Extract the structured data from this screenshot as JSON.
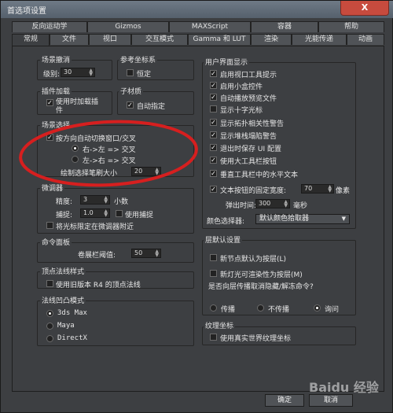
{
  "window": {
    "title": "首选项设置",
    "close": "X"
  },
  "tabs_row1": [
    "反向运动学",
    "Gizmos",
    "MAXScript",
    "容器",
    "帮助"
  ],
  "tabs_row2": [
    "常规",
    "文件",
    "视口",
    "交互模式",
    "Gamma 和 LUT",
    "渲染",
    "光能传递",
    "动画"
  ],
  "scene_undo": {
    "title": "场景撤消",
    "levels_label": "级别:",
    "levels_value": "30"
  },
  "ref_coord": {
    "title": "参考坐标系",
    "constant_label": "恒定"
  },
  "plugin_load": {
    "title": "插件加载",
    "load_on_demand": "使用时加载插件"
  },
  "sub_material": {
    "title": "子材质",
    "auto_assign": "自动指定"
  },
  "scene_select": {
    "title": "场景选择",
    "auto_switch": "按方向自动切换窗口/交叉",
    "right_left": "右->左 => 交叉",
    "left_right": "左->右 => 交叉",
    "paint_size_label": "绘制选择笔刷大小",
    "paint_size_value": "20"
  },
  "spinners": {
    "title": "微调器",
    "precision_label": "精度:",
    "precision_value": "3",
    "decimals": "小数",
    "snap_label": "捕捉:",
    "snap_value": "1.0",
    "use_snap": "使用捕捉",
    "cursor_wrap": "将光标限定在微调器附近"
  },
  "command_panel": {
    "title": "命令面板",
    "rollup_label": "卷展栏阈值:",
    "rollup_value": "50"
  },
  "vertex_normal": {
    "title": "顶点法线样式",
    "legacy": "使用旧版本 R4 的顶点法线"
  },
  "gizmo_mode": {
    "title": "法线凹凸模式",
    "options": [
      "3ds Max",
      "Maya",
      "DirectX"
    ]
  },
  "ui_display": {
    "title": "用户界面显示",
    "items": [
      "启用视口工具提示",
      "启用小盒控件",
      "自动播放预览文件",
      "显示十字光标",
      "显示拓扑相关性警告",
      "显示堆栈塌陷警告",
      "退出时保存 UI 配置",
      "使用大工具栏按钮",
      "垂直工具栏中的水平文本"
    ],
    "fixed_width_label": "文本按钮的固定宽度:",
    "fixed_width_value": "70",
    "pixels": "像素",
    "flyout_label": "弹出时间:",
    "flyout_value": "300",
    "ms": "毫秒",
    "color_picker_label": "颜色选择器:",
    "color_picker_value": "默认颜色拾取器"
  },
  "layer_defaults": {
    "title": "层默认设置",
    "new_nodes": "新节点默认为按层(L)",
    "new_lights": "新灯光可渲染性为按层(M)",
    "propagate_q": "是否向层传播取消隐藏/解冻命令?",
    "options": [
      "传播",
      "不传播",
      "询问"
    ]
  },
  "texture_coords": {
    "title": "纹理坐标",
    "real_world": "使用真实世界纹理坐标"
  },
  "footer": {
    "ok": "确定",
    "cancel": "取消"
  },
  "annotation_color": "#d61f1f",
  "watermark": "Baidu 经验"
}
